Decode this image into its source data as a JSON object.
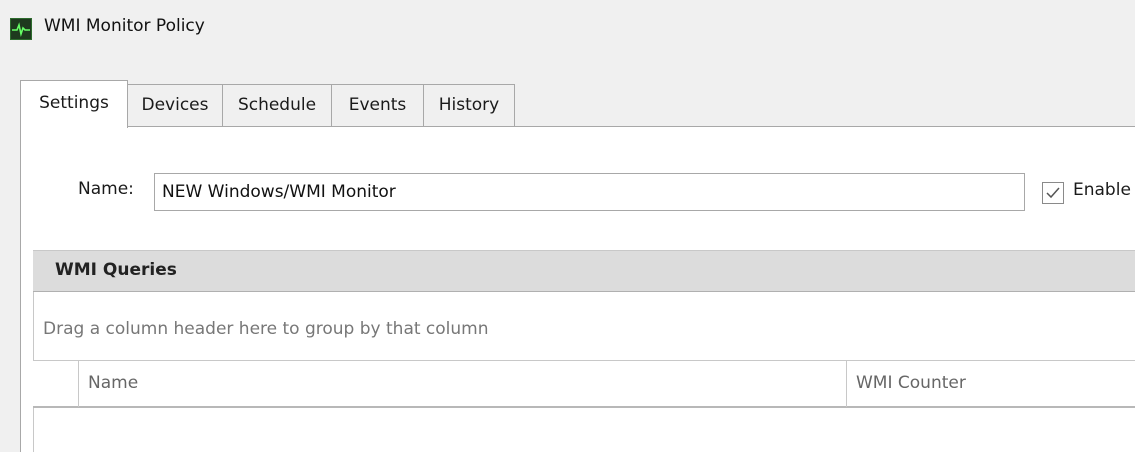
{
  "window": {
    "title": "WMI Monitor Policy",
    "icon": "monitor-pulse-icon"
  },
  "tabs": [
    {
      "label": "Settings",
      "active": true
    },
    {
      "label": "Devices",
      "active": false
    },
    {
      "label": "Schedule",
      "active": false
    },
    {
      "label": "Events",
      "active": false
    },
    {
      "label": "History",
      "active": false
    }
  ],
  "settings": {
    "name_label": "Name:",
    "name_value": "NEW Windows/WMI Monitor",
    "enable_label": "Enable",
    "enable_checked": true
  },
  "wmi_queries": {
    "title": "WMI Queries",
    "group_panel_text": "Drag a column header here to group by that column",
    "columns": [
      "Name",
      "WMI Counter"
    ]
  },
  "colors": {
    "background": "#f0f0f0",
    "group_header": "#dcdcdc",
    "border": "#a8a8a8"
  }
}
